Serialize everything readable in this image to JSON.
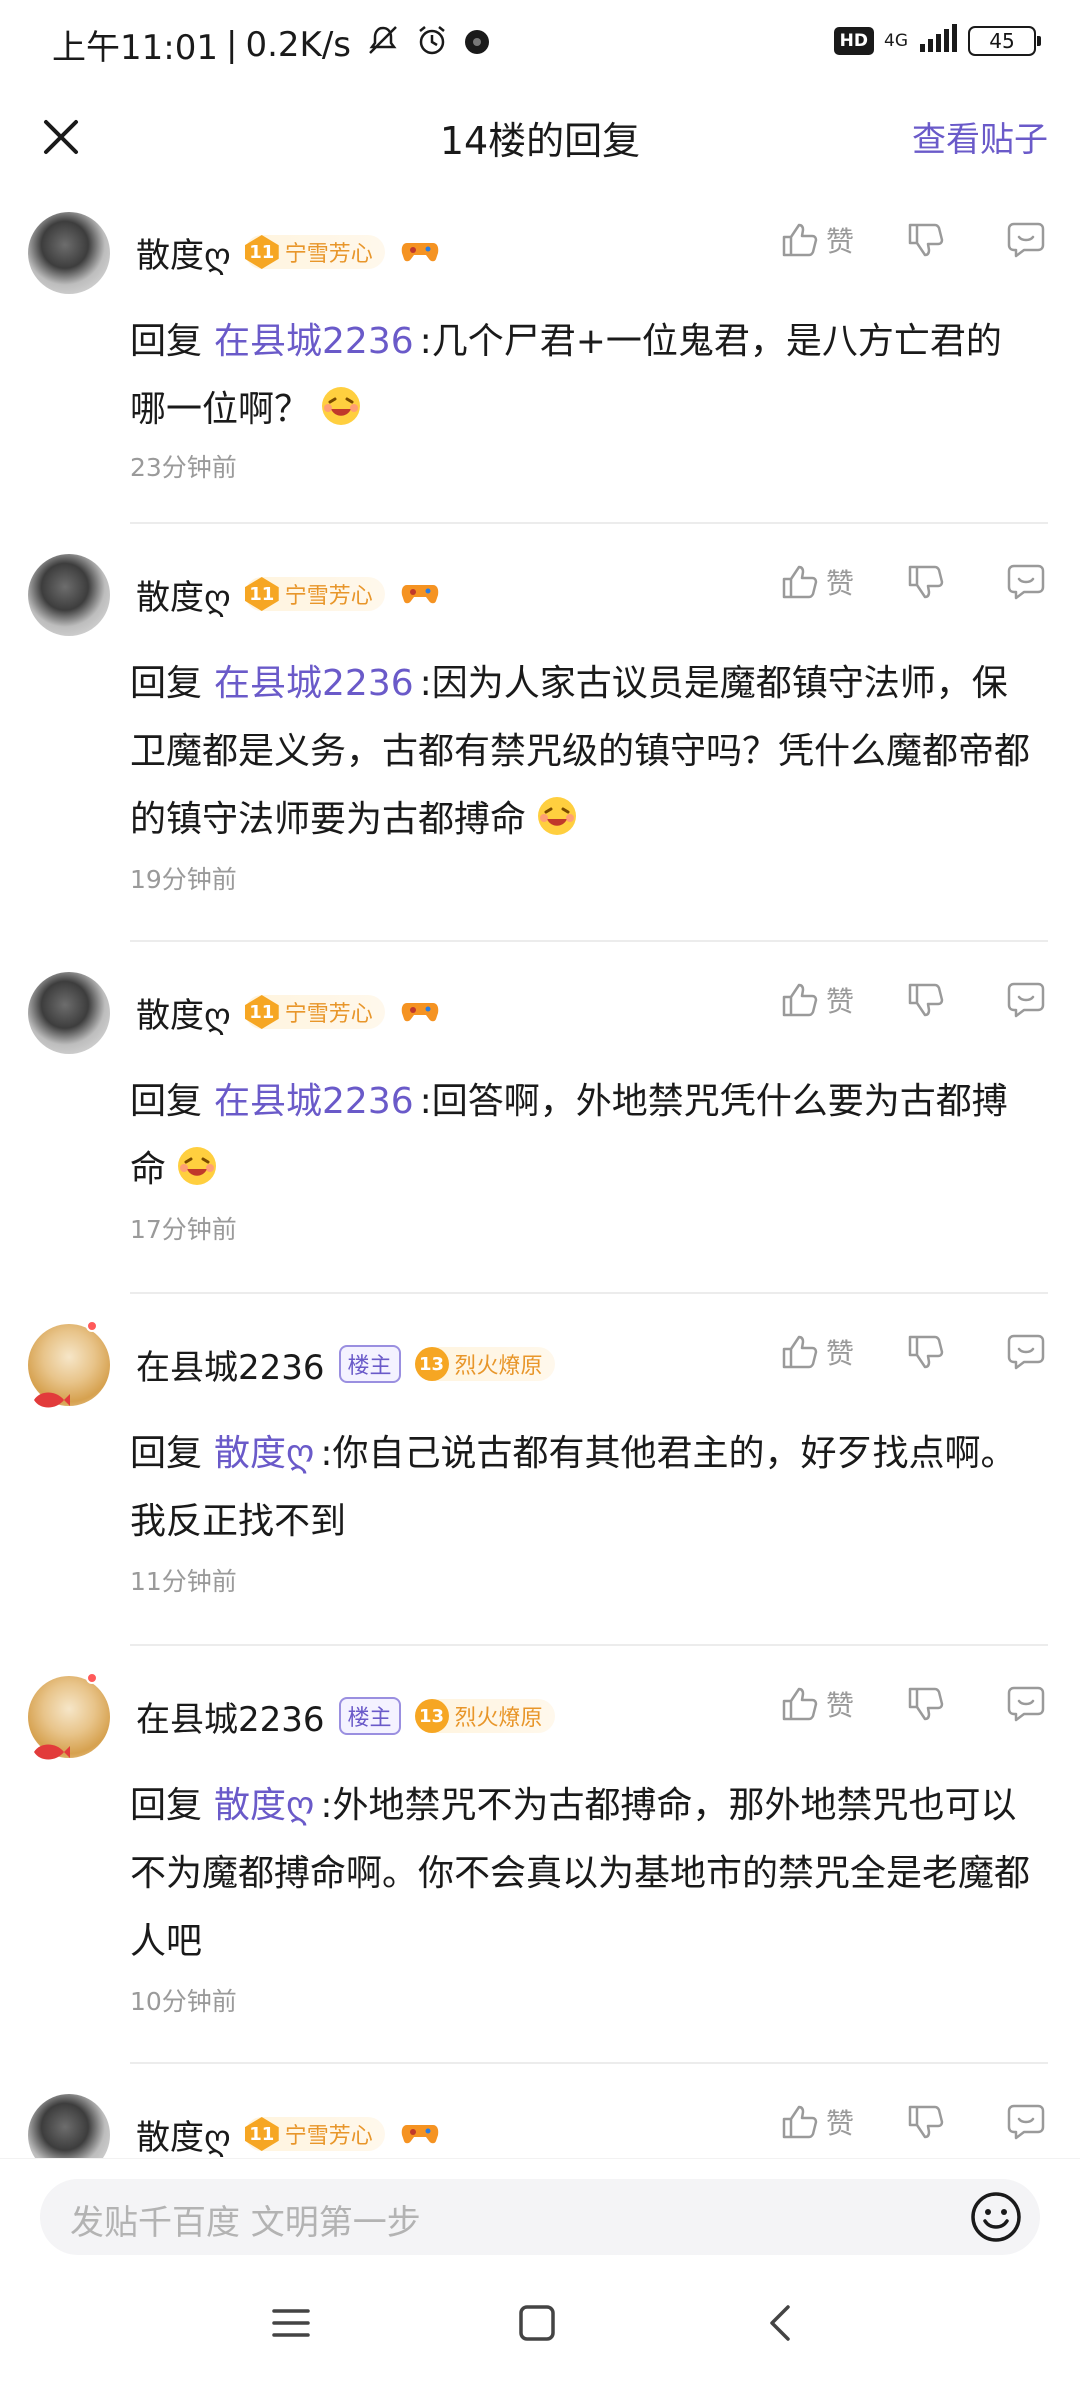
{
  "status_bar": {
    "time": "上午11:01",
    "speed": "0.2K/s",
    "hd": "HD",
    "network": "4G",
    "battery": "45"
  },
  "nav": {
    "title": "14楼的回复",
    "view_post": "查看贴子"
  },
  "common": {
    "like_label": "赞",
    "reply_word": "回复"
  },
  "comments": [
    {
      "username": "散度ღ",
      "level": "11",
      "level_name": "宁雪芳心",
      "mention": "在县城2236",
      "text": ":几个尸君+一位鬼君，是八方亡君的哪一位啊？",
      "time": "23分钟前"
    },
    {
      "username": "散度ღ",
      "level": "11",
      "level_name": "宁雪芳心",
      "mention": "在县城2236",
      "text": ":因为人家古议员是魔都镇守法师，保卫魔都是义务，古都有禁咒级的镇守吗？凭什么魔都帝都的镇守法师要为古都搏命",
      "time": "19分钟前"
    },
    {
      "username": "散度ღ",
      "level": "11",
      "level_name": "宁雪芳心",
      "mention": "在县城2236",
      "text": ":回答啊，外地禁咒凭什么要为古都搏命",
      "time": "17分钟前"
    },
    {
      "username": "在县城2236",
      "host_tag": "楼主",
      "level": "13",
      "level_name": "烈火燎原",
      "mention": "散度ღ",
      "text": ":你自己说古都有其他君主的，好歹找点啊。我反正找不到",
      "time": "11分钟前"
    },
    {
      "username": "在县城2236",
      "host_tag": "楼主",
      "level": "13",
      "level_name": "烈火燎原",
      "mention": "散度ღ",
      "text": ":外地禁咒不为古都搏命，那外地禁咒也可以不为魔都搏命啊。你不会真以为基地市的禁咒全是老魔都人吧",
      "time": "10分钟前"
    },
    {
      "username": "散度ღ",
      "level": "11",
      "level_name": "宁雪芳心"
    }
  ],
  "input": {
    "placeholder": "发贴千百度 文明第一步"
  },
  "colors": {
    "accent": "#6a5ac9",
    "badge_orange": "#f6a623",
    "muted": "#9a9a9a"
  }
}
